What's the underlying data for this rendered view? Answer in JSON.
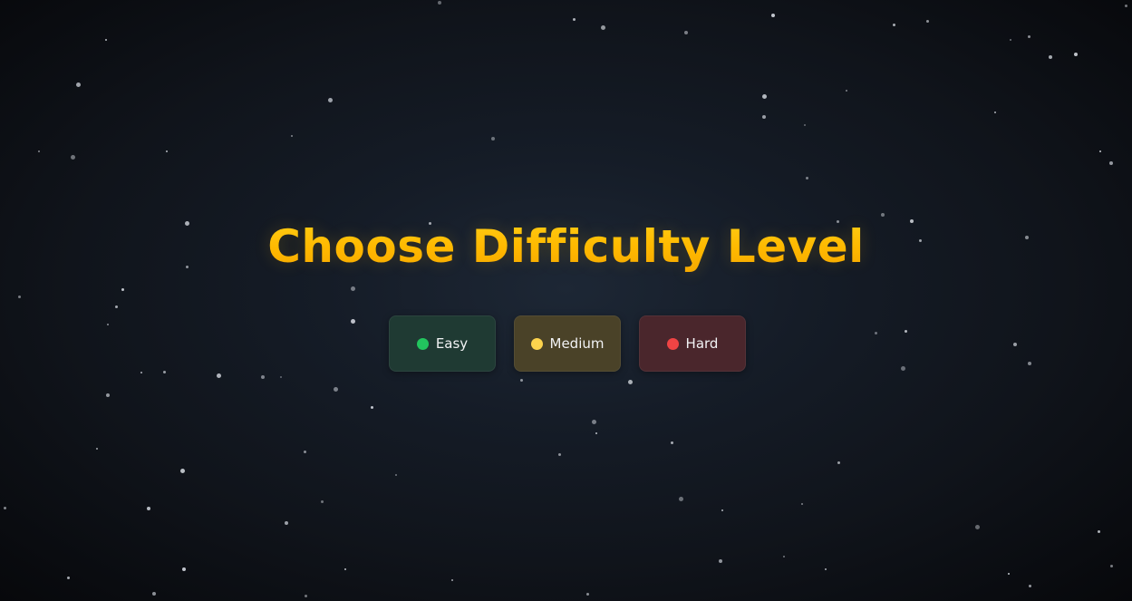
{
  "title": "Choose Difficulty Level",
  "difficulties": [
    {
      "label": "Easy",
      "indicator_icon": "green-dot-icon",
      "indicator_color": "#22c55e"
    },
    {
      "label": "Medium",
      "indicator_icon": "yellow-dot-icon",
      "indicator_color": "#fcd34d"
    },
    {
      "label": "Hard",
      "indicator_icon": "red-dot-icon",
      "indicator_color": "#ef4444"
    }
  ],
  "colors": {
    "title": "#ffc107",
    "background": "#111820"
  }
}
